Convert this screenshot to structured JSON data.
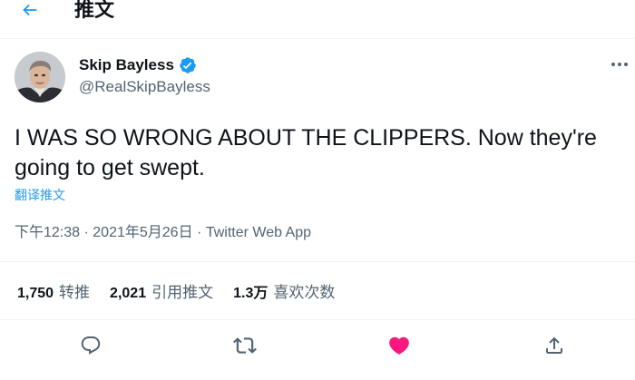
{
  "header": {
    "title": "推文",
    "back_icon": "arrow-left-icon"
  },
  "author": {
    "name": "Skip Bayless",
    "handle": "@RealSkipBayless",
    "verified_icon": "verified-badge-icon",
    "more_icon": "more-horizontal-icon"
  },
  "tweet": {
    "text": "I WAS SO WRONG ABOUT THE CLIPPERS. Now they're going to get swept.",
    "translate_label": "翻译推文"
  },
  "meta": {
    "time": "下午12:38",
    "separator": "·",
    "date": "2021年5月26日",
    "source": "Twitter Web App"
  },
  "stats": [
    {
      "value": "1,750",
      "label": "转推"
    },
    {
      "value": "2,021",
      "label": "引用推文"
    },
    {
      "value": "1.3万",
      "label": "喜欢次数"
    }
  ],
  "actions": {
    "reply_icon": "reply-icon",
    "retweet_icon": "retweet-icon",
    "like_icon": "heart-filled-icon",
    "share_icon": "share-icon"
  },
  "colors": {
    "accent": "#1d9bf0",
    "like": "#f91880",
    "secondary_text": "#536471",
    "border": "#eff3f4"
  }
}
